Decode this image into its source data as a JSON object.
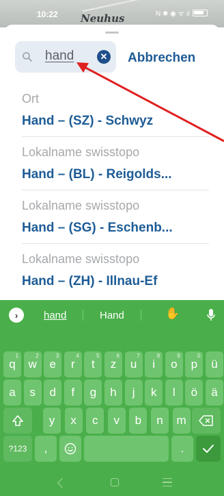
{
  "status_bar": {
    "time": "10:22",
    "icons": "N ✱ ◉ ᯤ ıl"
  },
  "map": {
    "label": "Neuhus"
  },
  "search": {
    "value": "hand",
    "cancel_label": "Abbrechen"
  },
  "results": [
    {
      "category": "Ort",
      "name": "Hand – (SZ) - Schwyz"
    },
    {
      "category": "Lokalname swisstopo",
      "name": "Hand – (BL) - Reigolds..."
    },
    {
      "category": "Lokalname swisstopo",
      "name": "Hand – (SG) - Eschenb..."
    },
    {
      "category": "Lokalname swisstopo",
      "name": "Hand – (ZH) - Illnau-Ef"
    }
  ],
  "keyboard": {
    "suggestions": [
      "hand",
      "Hand"
    ],
    "suggestion_emoji": "✋",
    "row1": [
      {
        "k": "q",
        "n": "1"
      },
      {
        "k": "w",
        "n": "2"
      },
      {
        "k": "e",
        "n": "3"
      },
      {
        "k": "r",
        "n": "4"
      },
      {
        "k": "t",
        "n": "5"
      },
      {
        "k": "z",
        "n": "6"
      },
      {
        "k": "u",
        "n": "7"
      },
      {
        "k": "i",
        "n": "8"
      },
      {
        "k": "o",
        "n": "9"
      },
      {
        "k": "p",
        "n": "0"
      },
      {
        "k": "ü",
        "n": ""
      }
    ],
    "row2": [
      "a",
      "s",
      "d",
      "f",
      "g",
      "h",
      "j",
      "k",
      "l",
      "ö",
      "ä"
    ],
    "row3": [
      "y",
      "x",
      "c",
      "v",
      "b",
      "n",
      "m"
    ],
    "symbols_label": "?123",
    "comma": ",",
    "period": "."
  },
  "colors": {
    "accent": "#1e5c96",
    "keyboard": "#4aaf4a",
    "arrow": "#e02020"
  }
}
